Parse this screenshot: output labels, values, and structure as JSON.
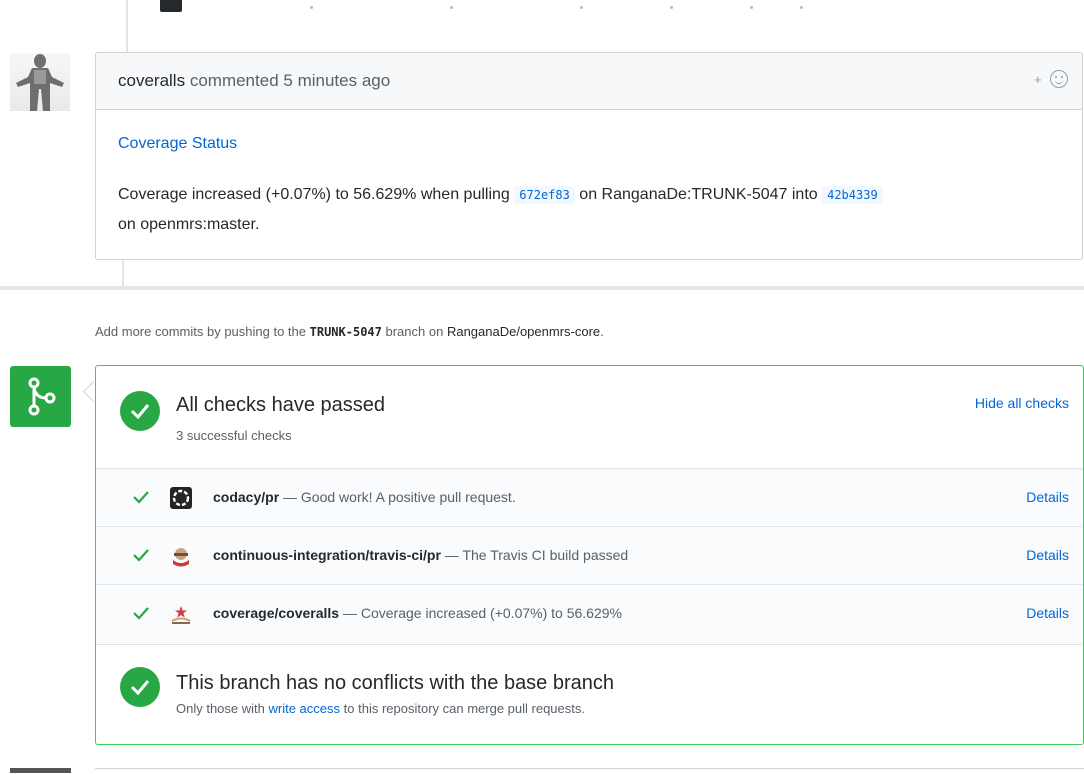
{
  "comment": {
    "author": "coveralls",
    "action": "commented",
    "time": "5 minutes ago",
    "link_text": "Coverage Status",
    "body_1": "Coverage increased (+0.07%) to 56.629% when pulling",
    "head_sha": "672ef83",
    "body_2": "on RanganaDe:TRUNK-5047 into",
    "base_sha": "42b4339",
    "body_3": "on openmrs:master."
  },
  "hint": {
    "prefix": "Add more commits by pushing to the",
    "branch": "TRUNK-5047",
    "middle": "branch on",
    "repo": "RanganaDe/openmrs-core",
    "suffix": "."
  },
  "checks": {
    "title": "All checks have passed",
    "subtitle": "3 successful checks",
    "hide_label": "Hide all checks",
    "items": [
      {
        "name": "codacy/pr",
        "separator": " — ",
        "description": "Good work! A positive pull request.",
        "details": "Details",
        "icon": "codacy-icon"
      },
      {
        "name": "continuous-integration/travis-ci/pr",
        "separator": " — ",
        "description": "The Travis CI build passed",
        "details": "Details",
        "icon": "travis-icon"
      },
      {
        "name": "coverage/coveralls",
        "separator": " — ",
        "description": "Coverage increased (+0.07%) to 56.629%",
        "details": "Details",
        "icon": "coveralls-icon"
      }
    ]
  },
  "merge": {
    "title": "This branch has no conflicts with the base branch",
    "sub_prefix": "Only those with",
    "sub_link": "write access",
    "sub_suffix": "to this repository can merge pull requests."
  },
  "colors": {
    "success": "#28a745",
    "link": "#0366d6",
    "border_success": "#34d058"
  }
}
